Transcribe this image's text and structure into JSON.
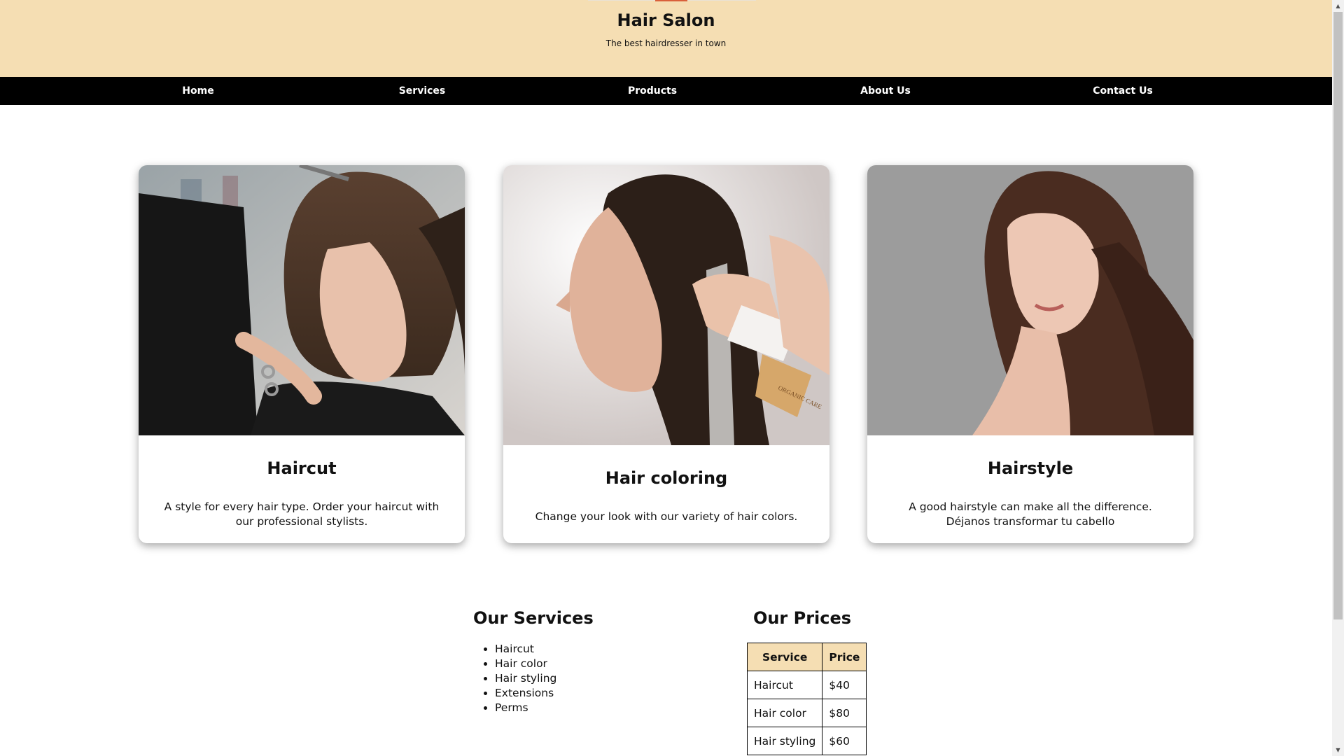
{
  "header": {
    "title": "Hair Salon",
    "tagline": "The best hairdresser in town",
    "background_color": "#f5deb3",
    "accent_color": "#d9603b"
  },
  "nav": {
    "background_color": "#000000",
    "items": [
      {
        "label": "Home"
      },
      {
        "label": "Services"
      },
      {
        "label": "Products"
      },
      {
        "label": "About Us"
      },
      {
        "label": "Contact Us"
      }
    ]
  },
  "cards": [
    {
      "title": "Haircut",
      "text": "A style for every hair type. Order your haircut with our professional stylists.",
      "image": "woman-getting-haircut-photo"
    },
    {
      "title": "Hair coloring",
      "text": "Change your look with our variety of hair colors.",
      "image": "woman-hair-coloring-photo",
      "brush_label": "ORGANIC CARE"
    },
    {
      "title": "Hairstyle",
      "text": "A good hairstyle can make all the difference. Déjanos transformar tu cabello",
      "image": "woman-wavy-hairstyle-photo"
    }
  ],
  "services": {
    "heading": "Our Services",
    "items": [
      "Haircut",
      "Hair color",
      "Hair styling",
      "Extensions",
      "Perms"
    ]
  },
  "prices": {
    "heading": "Our Prices",
    "columns": [
      "Service",
      "Price"
    ],
    "rows": [
      [
        "Haircut",
        "$40"
      ],
      [
        "Hair color",
        "$80"
      ],
      [
        "Hair styling",
        "$60"
      ]
    ],
    "header_color": "#f5deb3"
  },
  "scrollbar": {
    "up_icon": "arrow-up-icon",
    "down_icon": "arrow-down-icon"
  }
}
